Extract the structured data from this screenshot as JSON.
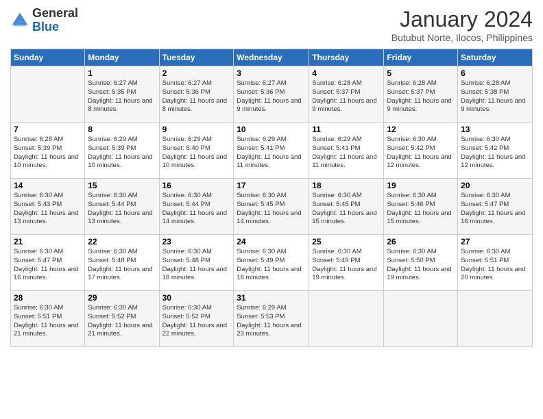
{
  "logo": {
    "general": "General",
    "blue": "Blue"
  },
  "header": {
    "month": "January 2024",
    "location": "Butubut Norte, Ilocos, Philippines"
  },
  "days_of_week": [
    "Sunday",
    "Monday",
    "Tuesday",
    "Wednesday",
    "Thursday",
    "Friday",
    "Saturday"
  ],
  "weeks": [
    [
      {
        "day": "",
        "sunrise": "",
        "sunset": "",
        "daylight": ""
      },
      {
        "day": "1",
        "sunrise": "Sunrise: 6:27 AM",
        "sunset": "Sunset: 5:35 PM",
        "daylight": "Daylight: 11 hours and 8 minutes."
      },
      {
        "day": "2",
        "sunrise": "Sunrise: 6:27 AM",
        "sunset": "Sunset: 5:36 PM",
        "daylight": "Daylight: 11 hours and 8 minutes."
      },
      {
        "day": "3",
        "sunrise": "Sunrise: 6:27 AM",
        "sunset": "Sunset: 5:36 PM",
        "daylight": "Daylight: 11 hours and 9 minutes."
      },
      {
        "day": "4",
        "sunrise": "Sunrise: 6:28 AM",
        "sunset": "Sunset: 5:37 PM",
        "daylight": "Daylight: 11 hours and 9 minutes."
      },
      {
        "day": "5",
        "sunrise": "Sunrise: 6:28 AM",
        "sunset": "Sunset: 5:37 PM",
        "daylight": "Daylight: 11 hours and 9 minutes."
      },
      {
        "day": "6",
        "sunrise": "Sunrise: 6:28 AM",
        "sunset": "Sunset: 5:38 PM",
        "daylight": "Daylight: 11 hours and 9 minutes."
      }
    ],
    [
      {
        "day": "7",
        "sunrise": "Sunrise: 6:28 AM",
        "sunset": "Sunset: 5:39 PM",
        "daylight": "Daylight: 11 hours and 10 minutes."
      },
      {
        "day": "8",
        "sunrise": "Sunrise: 6:29 AM",
        "sunset": "Sunset: 5:39 PM",
        "daylight": "Daylight: 11 hours and 10 minutes."
      },
      {
        "day": "9",
        "sunrise": "Sunrise: 6:29 AM",
        "sunset": "Sunset: 5:40 PM",
        "daylight": "Daylight: 11 hours and 10 minutes."
      },
      {
        "day": "10",
        "sunrise": "Sunrise: 6:29 AM",
        "sunset": "Sunset: 5:41 PM",
        "daylight": "Daylight: 11 hours and 11 minutes."
      },
      {
        "day": "11",
        "sunrise": "Sunrise: 6:29 AM",
        "sunset": "Sunset: 5:41 PM",
        "daylight": "Daylight: 11 hours and 11 minutes."
      },
      {
        "day": "12",
        "sunrise": "Sunrise: 6:30 AM",
        "sunset": "Sunset: 5:42 PM",
        "daylight": "Daylight: 11 hours and 12 minutes."
      },
      {
        "day": "13",
        "sunrise": "Sunrise: 6:30 AM",
        "sunset": "Sunset: 5:42 PM",
        "daylight": "Daylight: 11 hours and 12 minutes."
      }
    ],
    [
      {
        "day": "14",
        "sunrise": "Sunrise: 6:30 AM",
        "sunset": "Sunset: 5:43 PM",
        "daylight": "Daylight: 11 hours and 13 minutes."
      },
      {
        "day": "15",
        "sunrise": "Sunrise: 6:30 AM",
        "sunset": "Sunset: 5:44 PM",
        "daylight": "Daylight: 11 hours and 13 minutes."
      },
      {
        "day": "16",
        "sunrise": "Sunrise: 6:30 AM",
        "sunset": "Sunset: 5:44 PM",
        "daylight": "Daylight: 11 hours and 14 minutes."
      },
      {
        "day": "17",
        "sunrise": "Sunrise: 6:30 AM",
        "sunset": "Sunset: 5:45 PM",
        "daylight": "Daylight: 11 hours and 14 minutes."
      },
      {
        "day": "18",
        "sunrise": "Sunrise: 6:30 AM",
        "sunset": "Sunset: 5:45 PM",
        "daylight": "Daylight: 11 hours and 15 minutes."
      },
      {
        "day": "19",
        "sunrise": "Sunrise: 6:30 AM",
        "sunset": "Sunset: 5:46 PM",
        "daylight": "Daylight: 11 hours and 15 minutes."
      },
      {
        "day": "20",
        "sunrise": "Sunrise: 6:30 AM",
        "sunset": "Sunset: 5:47 PM",
        "daylight": "Daylight: 11 hours and 16 minutes."
      }
    ],
    [
      {
        "day": "21",
        "sunrise": "Sunrise: 6:30 AM",
        "sunset": "Sunset: 5:47 PM",
        "daylight": "Daylight: 11 hours and 16 minutes."
      },
      {
        "day": "22",
        "sunrise": "Sunrise: 6:30 AM",
        "sunset": "Sunset: 5:48 PM",
        "daylight": "Daylight: 11 hours and 17 minutes."
      },
      {
        "day": "23",
        "sunrise": "Sunrise: 6:30 AM",
        "sunset": "Sunset: 5:48 PM",
        "daylight": "Daylight: 11 hours and 18 minutes."
      },
      {
        "day": "24",
        "sunrise": "Sunrise: 6:30 AM",
        "sunset": "Sunset: 5:49 PM",
        "daylight": "Daylight: 11 hours and 18 minutes."
      },
      {
        "day": "25",
        "sunrise": "Sunrise: 6:30 AM",
        "sunset": "Sunset: 5:49 PM",
        "daylight": "Daylight: 11 hours and 19 minutes."
      },
      {
        "day": "26",
        "sunrise": "Sunrise: 6:30 AM",
        "sunset": "Sunset: 5:50 PM",
        "daylight": "Daylight: 11 hours and 19 minutes."
      },
      {
        "day": "27",
        "sunrise": "Sunrise: 6:30 AM",
        "sunset": "Sunset: 5:51 PM",
        "daylight": "Daylight: 11 hours and 20 minutes."
      }
    ],
    [
      {
        "day": "28",
        "sunrise": "Sunrise: 6:30 AM",
        "sunset": "Sunset: 5:51 PM",
        "daylight": "Daylight: 11 hours and 21 minutes."
      },
      {
        "day": "29",
        "sunrise": "Sunrise: 6:30 AM",
        "sunset": "Sunset: 5:52 PM",
        "daylight": "Daylight: 11 hours and 21 minutes."
      },
      {
        "day": "30",
        "sunrise": "Sunrise: 6:30 AM",
        "sunset": "Sunset: 5:52 PM",
        "daylight": "Daylight: 11 hours and 22 minutes."
      },
      {
        "day": "31",
        "sunrise": "Sunrise: 6:29 AM",
        "sunset": "Sunset: 5:53 PM",
        "daylight": "Daylight: 11 hours and 23 minutes."
      },
      {
        "day": "",
        "sunrise": "",
        "sunset": "",
        "daylight": ""
      },
      {
        "day": "",
        "sunrise": "",
        "sunset": "",
        "daylight": ""
      },
      {
        "day": "",
        "sunrise": "",
        "sunset": "",
        "daylight": ""
      }
    ]
  ]
}
